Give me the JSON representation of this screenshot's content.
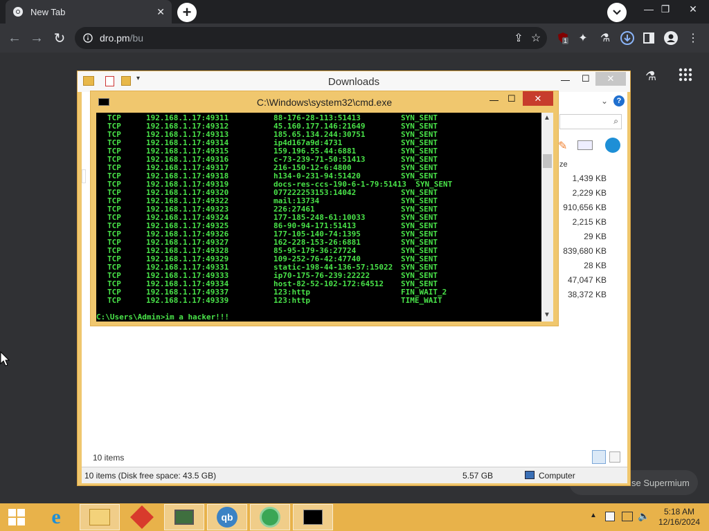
{
  "browser": {
    "tab_title": "New Tab",
    "url_host": "dro.pm",
    "url_path": "/bu",
    "extension_badge": "1"
  },
  "explorer": {
    "title": "Downloads",
    "column_header_partial": "ze",
    "sizes": [
      "1,439 KB",
      "2,229 KB",
      "910,656 KB",
      "2,215 KB",
      "29 KB",
      "839,680 KB",
      "28 KB",
      "47,047 KB",
      "38,372 KB"
    ],
    "item_count": "10 items",
    "status_left": "10 items (Disk free space: 43.5 GB)",
    "status_size": "5.57 GB",
    "status_location": "Computer"
  },
  "cmd": {
    "title": "C:\\Windows\\system32\\cmd.exe",
    "rows": [
      {
        "proto": "TCP",
        "local": "192.168.1.17:49311",
        "foreign": "88-176-28-113:51413",
        "state": "SYN_SENT"
      },
      {
        "proto": "TCP",
        "local": "192.168.1.17:49312",
        "foreign": "45.160.177.146:21649",
        "state": "SYN_SENT"
      },
      {
        "proto": "TCP",
        "local": "192.168.1.17:49313",
        "foreign": "185.65.134.244:30751",
        "state": "SYN_SENT"
      },
      {
        "proto": "TCP",
        "local": "192.168.1.17:49314",
        "foreign": "ip4d167a9d:4731",
        "state": "SYN_SENT"
      },
      {
        "proto": "TCP",
        "local": "192.168.1.17:49315",
        "foreign": "159.196.55.44:6881",
        "state": "SYN_SENT"
      },
      {
        "proto": "TCP",
        "local": "192.168.1.17:49316",
        "foreign": "c-73-239-71-50:51413",
        "state": "SYN_SENT"
      },
      {
        "proto": "TCP",
        "local": "192.168.1.17:49317",
        "foreign": "216-150-12-6:4800",
        "state": "SYN_SENT"
      },
      {
        "proto": "TCP",
        "local": "192.168.1.17:49318",
        "foreign": "h134-0-231-94:51420",
        "state": "SYN_SENT"
      },
      {
        "proto": "TCP",
        "local": "192.168.1.17:49319",
        "foreign": "docs-res-ccs-190-6-1-79:51413",
        "state": "SYN_SENT"
      },
      {
        "proto": "TCP",
        "local": "192.168.1.17:49320",
        "foreign": "077222253153:14042",
        "state": "SYN_SENT"
      },
      {
        "proto": "TCP",
        "local": "192.168.1.17:49322",
        "foreign": "mail:13734",
        "state": "SYN_SENT"
      },
      {
        "proto": "TCP",
        "local": "192.168.1.17:49323",
        "foreign": "226:27461",
        "state": "SYN_SENT"
      },
      {
        "proto": "TCP",
        "local": "192.168.1.17:49324",
        "foreign": "177-185-248-61:10033",
        "state": "SYN_SENT"
      },
      {
        "proto": "TCP",
        "local": "192.168.1.17:49325",
        "foreign": "86-90-94-171:51413",
        "state": "SYN_SENT"
      },
      {
        "proto": "TCP",
        "local": "192.168.1.17:49326",
        "foreign": "177-105-140-74:1395",
        "state": "SYN_SENT"
      },
      {
        "proto": "TCP",
        "local": "192.168.1.17:49327",
        "foreign": "162-228-153-26:6881",
        "state": "SYN_SENT"
      },
      {
        "proto": "TCP",
        "local": "192.168.1.17:49328",
        "foreign": "85-95-179-36:27724",
        "state": "SYN_SENT"
      },
      {
        "proto": "TCP",
        "local": "192.168.1.17:49329",
        "foreign": "109-252-76-42:47740",
        "state": "SYN_SENT"
      },
      {
        "proto": "TCP",
        "local": "192.168.1.17:49331",
        "foreign": "static-198-44-136-57:15022",
        "state": "SYN_SENT"
      },
      {
        "proto": "TCP",
        "local": "192.168.1.17:49333",
        "foreign": "ip70-175-76-239:22222",
        "state": "SYN_SENT"
      },
      {
        "proto": "TCP",
        "local": "192.168.1.17:49334",
        "foreign": "host-82-52-102-172:64512",
        "state": "SYN_SENT"
      },
      {
        "proto": "TCP",
        "local": "192.168.1.17:49337",
        "foreign": "123:http",
        "state": "FIN_WAIT_2"
      },
      {
        "proto": "TCP",
        "local": "192.168.1.17:49339",
        "foreign": "123:http",
        "state": "TIME_WAIT"
      }
    ],
    "prompt": "C:\\Users\\Admin>im a hacker!!!"
  },
  "background_text": "se Supermium",
  "taskbar": {
    "time": "5:18 AM",
    "date": "12/16/2024"
  },
  "colors": {
    "accent": "#e8b24a",
    "terminal_text": "#49e349",
    "chrome_dark": "#202124"
  }
}
